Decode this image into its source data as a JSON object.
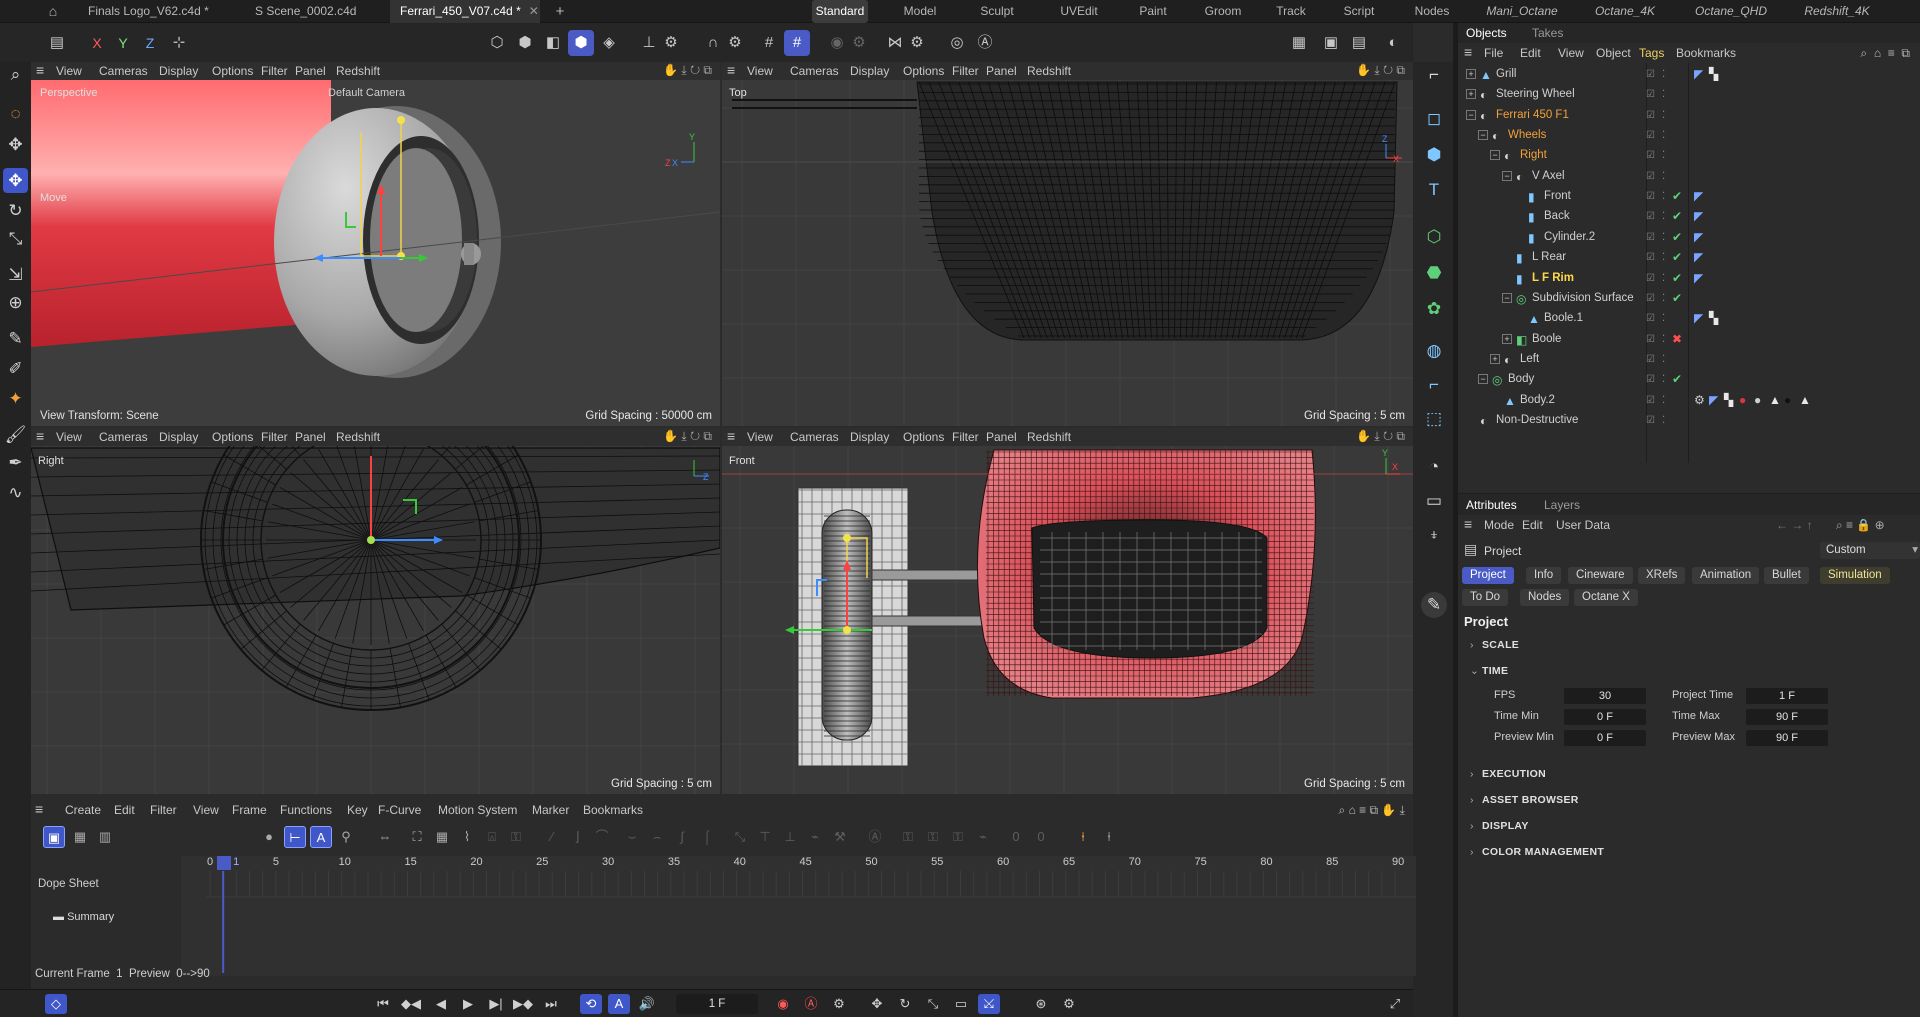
{
  "file_tabs": [
    {
      "label": "Finals Logo_V62.c4d *",
      "active": false
    },
    {
      "label": "S Scene_0002.c4d",
      "active": false
    },
    {
      "label": "Ferrari_450_V07.c4d *",
      "active": true
    }
  ],
  "layouts": [
    {
      "label": "Standard",
      "active": true
    },
    {
      "label": "Model"
    },
    {
      "label": "Sculpt"
    },
    {
      "label": "UVEdit"
    },
    {
      "label": "Paint"
    },
    {
      "label": "Groom"
    },
    {
      "label": "Track"
    },
    {
      "label": "Script"
    },
    {
      "label": "Nodes"
    },
    {
      "label": "Mani_Octane",
      "italic": true
    },
    {
      "label": "Octane_4K",
      "italic": true
    },
    {
      "label": "Octane_QHD",
      "italic": true
    },
    {
      "label": "Redshift_4K",
      "italic": true
    }
  ],
  "toolbar": {
    "axis_x": "X",
    "axis_y": "Y",
    "axis_z": "Z"
  },
  "viewport_menu": [
    "View",
    "Cameras",
    "Display",
    "Options",
    "Filter",
    "Panel",
    "Redshift"
  ],
  "viewports": {
    "perspective": {
      "name": "Perspective",
      "camera": "Default Camera",
      "tool": "Move",
      "transform": "View Transform: Scene",
      "grid": "Grid Spacing : 50000 cm"
    },
    "top": {
      "name": "Top",
      "grid": "Grid Spacing : 5 cm"
    },
    "right": {
      "name": "Right",
      "grid": "Grid Spacing : 5 cm"
    },
    "front": {
      "name": "Front",
      "grid": "Grid Spacing : 5 cm"
    }
  },
  "objects_panel": {
    "tabs": [
      "Objects",
      "Takes"
    ],
    "menu": [
      "File",
      "Edit",
      "View",
      "Object",
      "Tags",
      "Bookmarks"
    ],
    "active_menu": "Tags",
    "rows": [
      {
        "label": "Grill",
        "style": "normal",
        "check": "",
        "tags": [
          "phong",
          "checker"
        ]
      },
      {
        "label": "Steering Wheel",
        "style": "normal",
        "check": "",
        "tags": []
      },
      {
        "label": "Ferrari 450 F1",
        "style": "orange",
        "check": "",
        "tags": []
      },
      {
        "label": "Wheels",
        "style": "orange",
        "check": "",
        "tags": []
      },
      {
        "label": "Right",
        "style": "orange",
        "check": "",
        "tags": []
      },
      {
        "label": "V Axel",
        "style": "normal",
        "check": "",
        "tags": []
      },
      {
        "label": "Front",
        "style": "normal",
        "check": "✔",
        "tags": [
          "phong"
        ]
      },
      {
        "label": "Back",
        "style": "normal",
        "check": "✔",
        "tags": [
          "phong"
        ]
      },
      {
        "label": "Cylinder.2",
        "style": "normal",
        "check": "✔",
        "tags": [
          "phong"
        ]
      },
      {
        "label": "L Rear",
        "style": "normal",
        "check": "✔",
        "tags": [
          "phong"
        ]
      },
      {
        "label": "L F Rim",
        "style": "yellow",
        "check": "✔",
        "tags": [
          "phong"
        ]
      },
      {
        "label": "Subdivision Surface",
        "style": "normal",
        "check": "✔",
        "tags": []
      },
      {
        "label": "Boole.1",
        "style": "normal",
        "check": "",
        "tags": [
          "phong",
          "checker"
        ]
      },
      {
        "label": "Boole",
        "style": "normal",
        "check": "✖",
        "tags": []
      },
      {
        "label": "Left",
        "style": "normal",
        "check": "",
        "tags": []
      },
      {
        "label": "Body",
        "style": "normal",
        "check": "✔",
        "tags": []
      },
      {
        "label": "Body.2",
        "style": "normal",
        "check": "",
        "tags": [
          "gear",
          "phong",
          "checker",
          "red-ball",
          "grey-ball",
          "tri",
          "black-ball",
          "tri"
        ]
      },
      {
        "label": "Non-Destructive",
        "style": "normal",
        "check": "",
        "tags": []
      }
    ]
  },
  "attributes": {
    "tabs": [
      "Attributes",
      "Layers"
    ],
    "menu": [
      "Mode",
      "Edit",
      "User Data"
    ],
    "title": "Project",
    "preset": "Custom",
    "buttons_row1": [
      "Project",
      "Info",
      "Cineware",
      "XRefs",
      "Animation",
      "Bullet",
      "Simulation"
    ],
    "buttons_row2": [
      "To Do",
      "Nodes",
      "Octane X"
    ],
    "heading": "Project",
    "sections": {
      "scale": "SCALE",
      "time": "TIME",
      "execution": "EXECUTION",
      "asset_browser": "ASSET BROWSER",
      "display": "DISPLAY",
      "color_management": "COLOR MANAGEMENT"
    },
    "fields": {
      "fps_label": "FPS",
      "fps": "30",
      "project_time_label": "Project Time",
      "project_time": "1 F",
      "time_min_label": "Time Min",
      "time_min": "0 F",
      "time_max_label": "Time Max",
      "time_max": "90 F",
      "preview_min_label": "Preview Min",
      "preview_min": "0 F",
      "preview_max_label": "Preview Max",
      "preview_max": "90 F"
    }
  },
  "timeline": {
    "menu": [
      "Create",
      "Edit",
      "Filter",
      "View",
      "Frame",
      "Functions",
      "Key",
      "F-Curve",
      "Motion System",
      "Marker",
      "Bookmarks"
    ],
    "ticks": [
      "0",
      "5",
      "10",
      "15",
      "20",
      "25",
      "30",
      "35",
      "40",
      "45",
      "50",
      "55",
      "60",
      "65",
      "70",
      "75",
      "80",
      "85",
      "90"
    ],
    "current_tick": "1",
    "current_frame": 1,
    "track_title": "Dope Sheet",
    "track_summary": "Summary",
    "status": "Current Frame  1  Preview  0-->90"
  },
  "bottom_bar": {
    "frame_field": "1 F"
  },
  "colors": {
    "accent": "#4a5bc6",
    "selected_orange": "#f2a13a",
    "active_yellow": "#ffd84a",
    "body_red": "#e0353f"
  }
}
